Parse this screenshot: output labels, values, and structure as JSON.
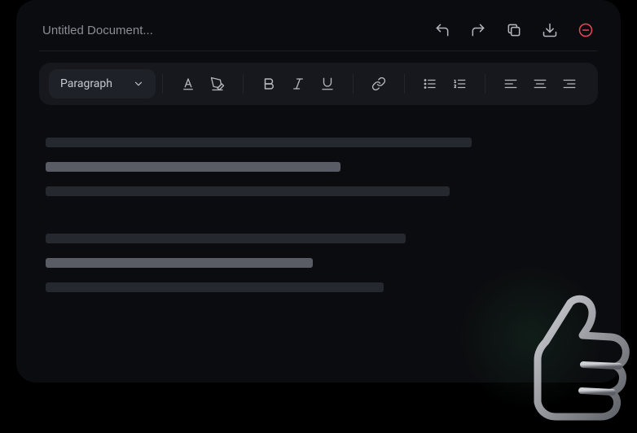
{
  "title": {
    "placeholder": "Untitled Document..."
  },
  "toolbar": {
    "style_label": "Paragraph"
  }
}
